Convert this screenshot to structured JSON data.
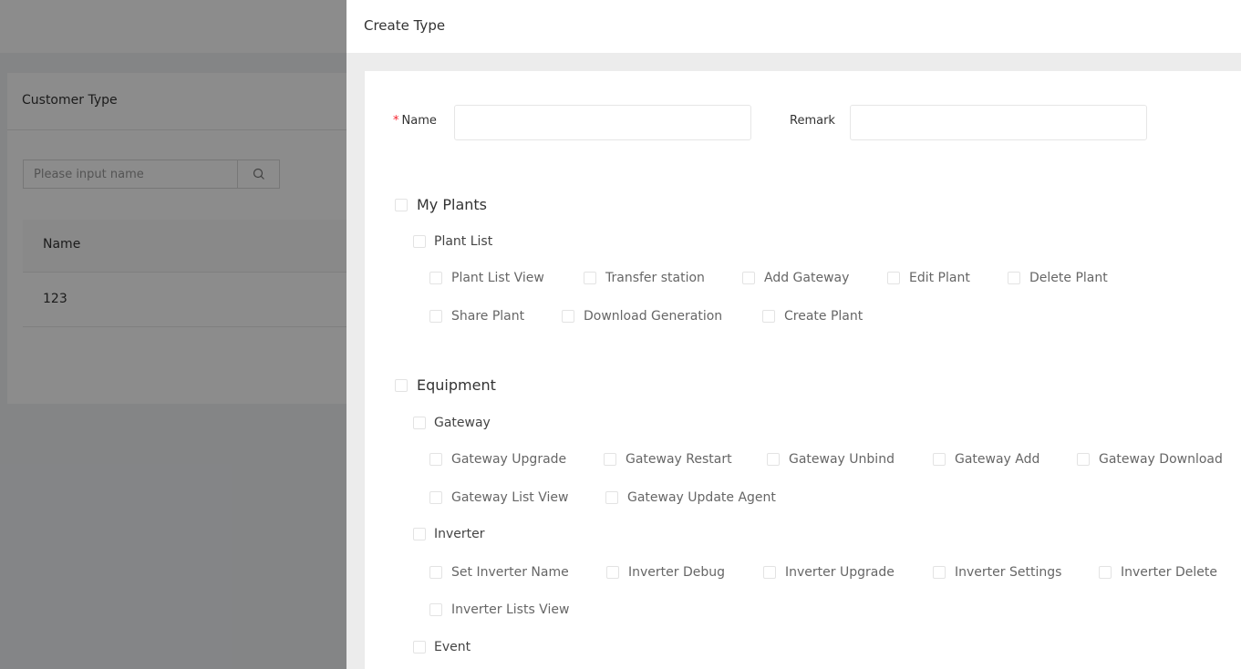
{
  "background": {
    "card_title": "Customer Type",
    "search": {
      "placeholder": "Please input name",
      "icon": "search-icon"
    },
    "table": {
      "columns": [
        "Name"
      ],
      "rows": [
        [
          "123"
        ]
      ]
    }
  },
  "drawer": {
    "title": "Create Type",
    "form": {
      "name_label": "Name",
      "required_mark": "*",
      "name_value": "",
      "remark_label": "Remark",
      "remark_value": ""
    },
    "permissions": {
      "my_plants": {
        "label": "My Plants",
        "plant_list": {
          "label": "Plant List",
          "items": [
            "Plant List View",
            "Transfer station",
            "Add Gateway",
            "Edit Plant",
            "Delete Plant",
            "Share Plant",
            "Download Generation",
            "Create Plant"
          ]
        }
      },
      "equipment": {
        "label": "Equipment",
        "gateway": {
          "label": "Gateway",
          "items": [
            "Gateway Upgrade",
            "Gateway Restart",
            "Gateway Unbind",
            "Gateway Add",
            "Gateway Download",
            "Gateway List View",
            "Gateway Update Agent"
          ]
        },
        "inverter": {
          "label": "Inverter",
          "items": [
            "Set Inverter Name",
            "Inverter Debug",
            "Inverter Upgrade",
            "Inverter Settings",
            "Inverter Delete",
            "Inverter Lists View"
          ]
        },
        "event": {
          "label": "Event"
        }
      }
    }
  },
  "colors": {
    "required": "#f5222d",
    "overlay": "rgba(0,0,0,0.45)",
    "drawer_bg": "#ececec"
  }
}
